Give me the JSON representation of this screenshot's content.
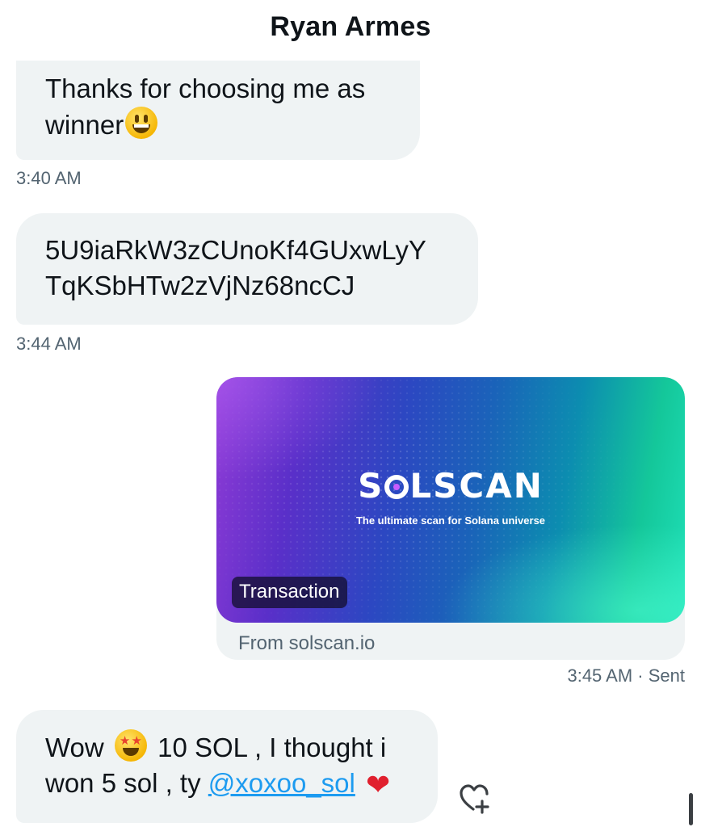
{
  "header": {
    "title": "Ryan Armes"
  },
  "messages": {
    "m1": {
      "text": "Thanks for choosing me as winner",
      "emoji": "grinning-face-emoji",
      "time": "3:40 AM"
    },
    "m2": {
      "line1": "5U9iaRkW3zCUnoKf4GUxwLyY",
      "line2": "TqKSbHTw2zVjNz68ncCJ",
      "time": "3:44 AM"
    },
    "card": {
      "logo_text": "SOLSCAN",
      "tagline": "The ultimate scan for Solana universe",
      "chip": "Transaction",
      "source": "From solscan.io",
      "time": "3:45 AM",
      "status": " · Sent"
    },
    "m3": {
      "part1": "Wow",
      "part2": " 10 SOL , I thought i",
      "part3": "won 5 sol , ty ",
      "mention": "@xoxoo_sol",
      "emoji_heart": "heart-emoji"
    }
  },
  "colors": {
    "bubble": "#eff3f4",
    "secondary_text": "#536471",
    "link": "#1d9bf0"
  }
}
